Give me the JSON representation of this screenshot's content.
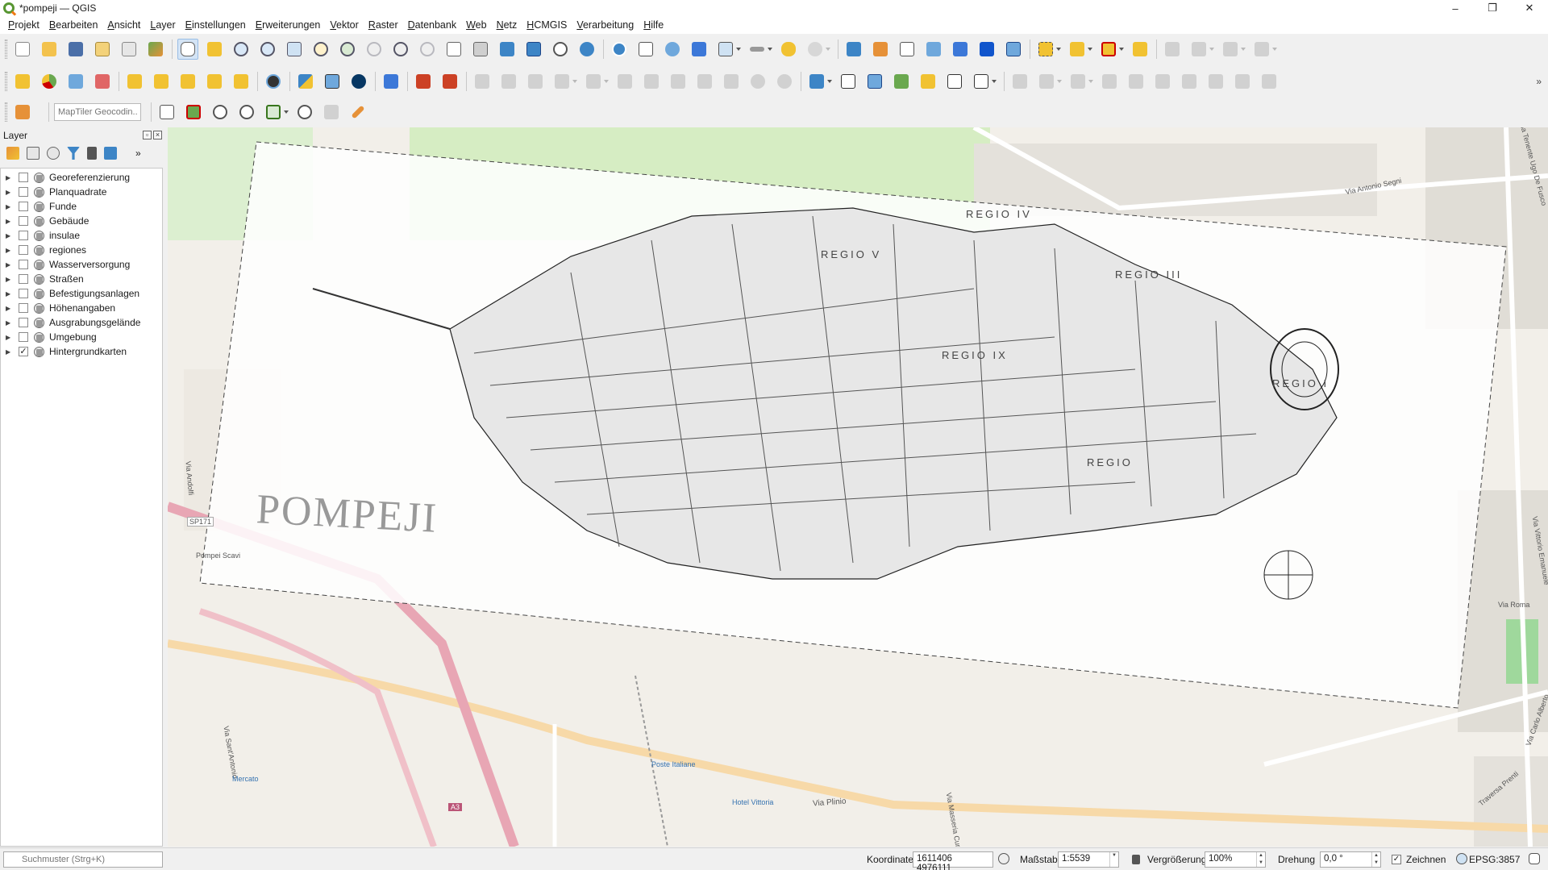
{
  "window": {
    "title": "*pompeji — QGIS",
    "minimize": "–",
    "maximize": "❐",
    "close": "✕"
  },
  "menu": [
    "Projekt",
    "Bearbeiten",
    "Ansicht",
    "Layer",
    "Einstellungen",
    "Erweiterungen",
    "Vektor",
    "Raster",
    "Datenbank",
    "Web",
    "Netz",
    "HCMGIS",
    "Verarbeitung",
    "Hilfe"
  ],
  "toolbar": {
    "geocoder_placeholder": "MapTiler Geocodin...",
    "more": "»"
  },
  "layers_panel": {
    "title": "Layer",
    "float_btn": "▫",
    "close_btn": "×",
    "more": "»",
    "layers": [
      {
        "name": "Georeferenzierung",
        "checked": false
      },
      {
        "name": "Planquadrate",
        "checked": false
      },
      {
        "name": "Funde",
        "checked": false
      },
      {
        "name": "Gebäude",
        "checked": false
      },
      {
        "name": "insulae",
        "checked": false
      },
      {
        "name": "regiones",
        "checked": false
      },
      {
        "name": "Wasserversorgung",
        "checked": false
      },
      {
        "name": "Straßen",
        "checked": false
      },
      {
        "name": "Befestigungsanlagen",
        "checked": false
      },
      {
        "name": "Höhenangaben",
        "checked": false
      },
      {
        "name": "Ausgrabungsgelände",
        "checked": false
      },
      {
        "name": "Umgebung",
        "checked": false
      },
      {
        "name": "Hintergrundkarten",
        "checked": true
      }
    ]
  },
  "map": {
    "title_text": "POMPEJI",
    "regio_labels": [
      "REGIO IV",
      "REGIO V",
      "REGIO III",
      "REGIO IX",
      "REGIO",
      "REGIO I"
    ],
    "street_labels": [
      "Via Antonio Segni",
      "Via Plinio",
      "Via Roma",
      "Via Andolfi",
      "Via Sant'Antonio",
      "Traversa Prenti",
      "Via Masseria Curato",
      "Via Vittorio Emanuele",
      "Via Carlo Alberto",
      "Via Tenente Ugo De Fusco",
      "SP171",
      "A3",
      "Pompei Scavi",
      "Poste Italiane",
      "Hotel Vittoria",
      "Mercato"
    ]
  },
  "status": {
    "search_placeholder": "Suchmuster (Strg+K)",
    "coord_label": "Koordinate",
    "coord_value": "1611406 4976111",
    "scale_label": "Maßstab",
    "scale_value": "1:5539",
    "mag_label": "Vergrößerung",
    "mag_value": "100%",
    "rot_label": "Drehung",
    "rot_value": "0,0 °",
    "render_label": "Zeichnen",
    "render_checked": "✓",
    "crs": "EPSG:3857"
  },
  "colors": {
    "accent": "#589632",
    "map_bg": "#f2efe9",
    "road_pink": "#e8a6b4",
    "road_orange": "#f7d9a8",
    "green": "#cdebb0"
  },
  "icons": [
    "new-project-icon",
    "open-icon",
    "save-icon",
    "pan-icon",
    "zoom-in-icon",
    "zoom-out-icon",
    "identify-icon",
    "python-icon",
    "help-icon",
    "georeferencer-icon",
    "search-icon",
    "messages-icon"
  ]
}
